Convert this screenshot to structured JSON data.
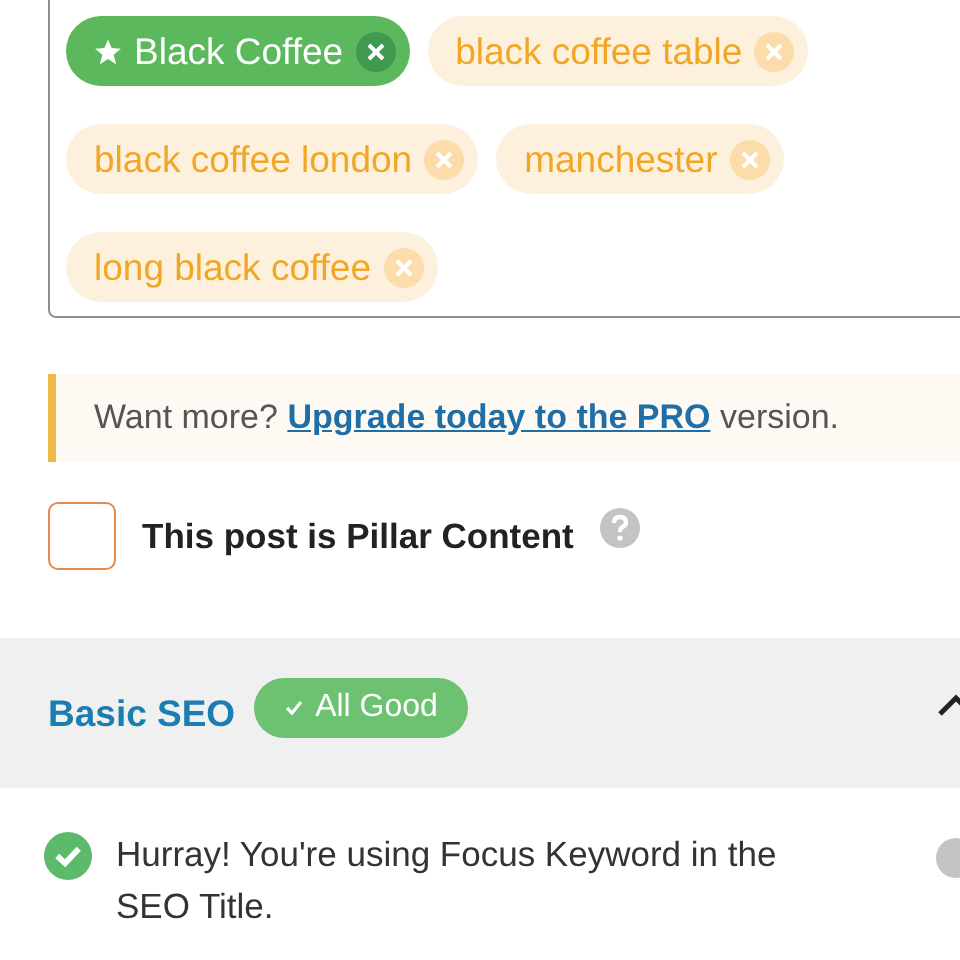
{
  "keywords": [
    {
      "label": "Black Coffee",
      "kind": "primary"
    },
    {
      "label": "black coffee table",
      "kind": "secondary"
    },
    {
      "label": "black coffee london",
      "kind": "secondary"
    },
    {
      "label": "manchester",
      "kind": "secondary"
    },
    {
      "label": "long black coffee",
      "kind": "secondary"
    }
  ],
  "notice": {
    "text": "Want more?",
    "link": "Upgrade today to the PRO",
    "after": "version."
  },
  "pillar": {
    "label": "This post is Pillar Content",
    "checked": false
  },
  "section": {
    "title": "Basic SEO",
    "badge": "All Good",
    "expanded": true,
    "checks": [
      {
        "text": "Hurray! You're using Focus Keyword in the SEO Title.",
        "passed": true
      }
    ]
  }
}
